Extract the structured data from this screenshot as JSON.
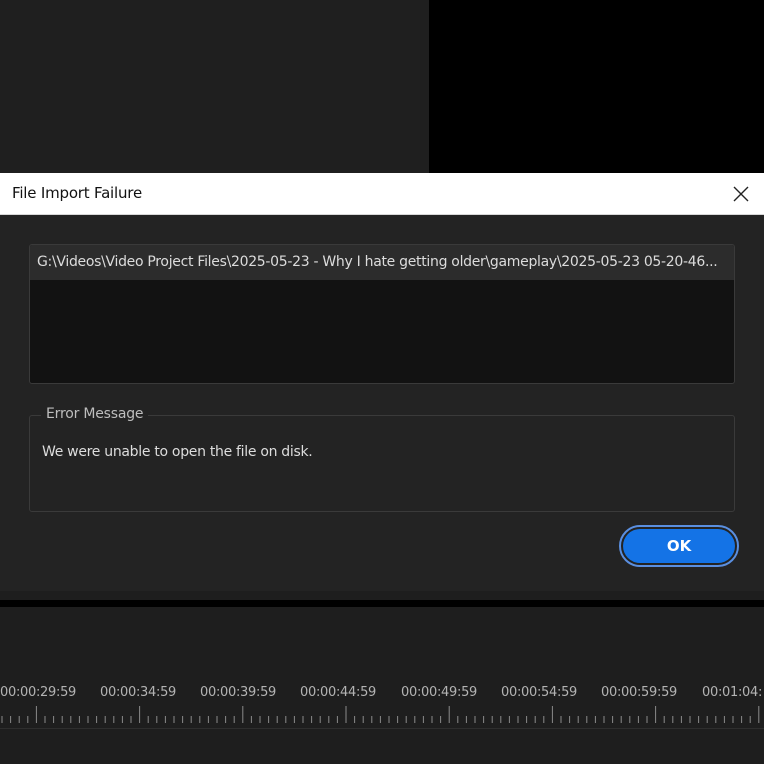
{
  "dialog": {
    "title": "File Import Failure",
    "file_path": "G:\\Videos\\Video Project Files\\2025-05-23 - Why I hate getting older\\gameplay\\2025-05-23 05-20-46...",
    "error_legend": "Error Message",
    "error_message": "We were unable to open the file on disk.",
    "ok_label": "OK",
    "accent_color": "#1473e6"
  },
  "timeline": {
    "timecodes": [
      "00:00:29:59",
      "00:00:34:59",
      "00:00:39:59",
      "00:00:44:59",
      "00:00:49:59",
      "00:00:54:59",
      "00:00:59:59",
      "00:01:04:"
    ]
  },
  "icons": {
    "close": "close-icon"
  }
}
